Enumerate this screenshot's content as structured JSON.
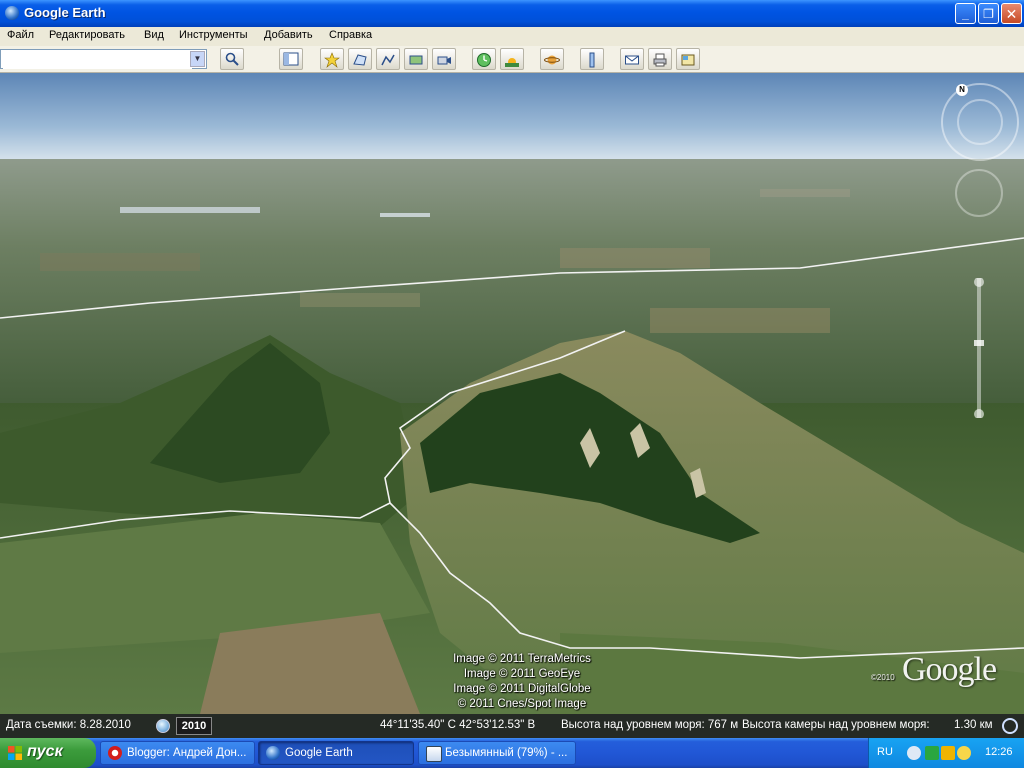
{
  "window": {
    "title": "Google Earth",
    "minimize_label": "_",
    "maximize_label": "❐",
    "close_label": "✕"
  },
  "menu": [
    "Файл",
    "Редактировать",
    "Вид",
    "Инструменты",
    "Добавить",
    "Справка"
  ],
  "search": {
    "value": "",
    "placeholder": ""
  },
  "toolbar": {
    "icons": [
      "search-icon",
      "sidebar-icon",
      "placemark-icon",
      "polygon-icon",
      "path-icon",
      "image-overlay-icon",
      "record-tour-icon",
      "historical-imagery-icon",
      "sunlight-icon",
      "planets-icon",
      "ruler-icon",
      "email-icon",
      "print-icon",
      "view-in-maps-icon"
    ]
  },
  "view": {
    "credits": [
      "Image © 2011 TerraMetrics",
      "Image © 2011 GeoEye",
      "Image © 2011 DigitalGlobe",
      "© 2011 Cnes/Spot Image"
    ],
    "logo": "Google",
    "logo_year": "©2010",
    "compass_north": "N"
  },
  "status": {
    "date_label": "Дата съемки: 8.28.2010",
    "year_button": "2010",
    "coordinates": "44°11'35.40\" С   42°53'12.53\" В",
    "elevation": "Высота над уровнем моря:  767 м",
    "eye_alt": "Высота камеры над уровнем моря:",
    "eye_alt_value": "1.30 км"
  },
  "taskbar": {
    "start": "пуск",
    "tasks": [
      {
        "label": "Blogger: Андрей Дон...",
        "icon": "opera-icon",
        "active": false
      },
      {
        "label": "Google Earth",
        "icon": "google-earth-icon",
        "active": true
      },
      {
        "label": "Безымянный (79%) - ...",
        "icon": "image-editor-icon",
        "active": false
      }
    ],
    "lang": "RU",
    "clock": "12:26"
  },
  "colors": {
    "title_bar": "#0054e3",
    "menu_bg": "#ece9d8",
    "sky_top": "#5d86b6",
    "ground": "#4a6a3a",
    "start_green": "#3c9c3c",
    "tray_blue": "#0f88e0"
  }
}
